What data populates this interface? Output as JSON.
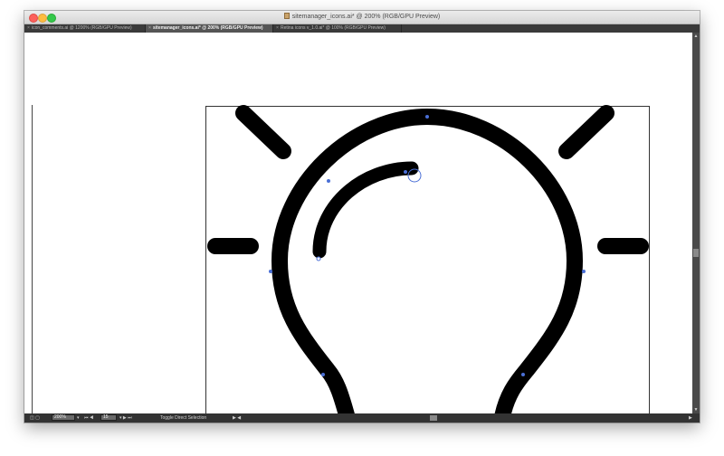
{
  "window": {
    "title": "sitemanager_icons.ai* @ 200% (RGB/GPU Preview)",
    "title_icon": "document-icon"
  },
  "tabs": [
    {
      "label": "icon_comments.ai @ 1200% (RGB/GPU Preview)",
      "active": false
    },
    {
      "label": "sitemanager_icons.ai* @ 200% (RGB/GPU Preview)",
      "active": true
    },
    {
      "label": "Retina icons v_1.0.ai* @ 100% (RGB/GPU Preview)",
      "active": false
    }
  ],
  "tab_close_glyph": "×",
  "artwork": {
    "subject": "lightbulb-icon",
    "stroke_color": "#000000",
    "selection_color": "#4a6fd6"
  },
  "statusbar": {
    "zoom": "200%",
    "artboard_number": "15",
    "tool_status": "Toggle Direct Selection"
  },
  "colors": {
    "chrome_dark": "#333333",
    "tab_active": "#555555",
    "canvas": "#ffffff"
  }
}
